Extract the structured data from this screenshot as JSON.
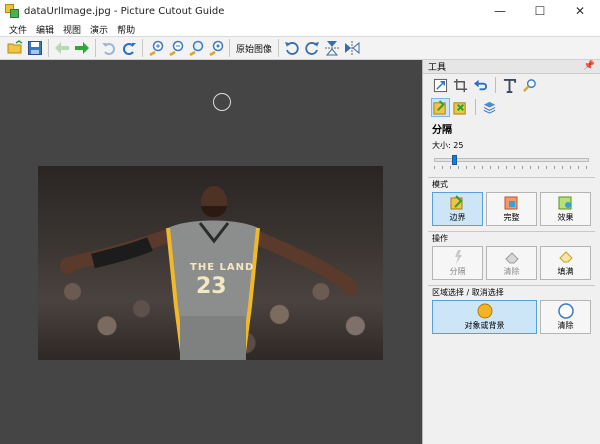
{
  "window": {
    "title": "dataUrlImage.jpg - Picture Cutout Guide",
    "minimize": "—",
    "maximize": "☐",
    "close": "✕"
  },
  "menu": [
    "文件",
    "编辑",
    "视图",
    "演示",
    "帮助"
  ],
  "toolbar": {
    "original_image_label": "原始图像",
    "icons": [
      "open-icon",
      "save-icon",
      "back-icon",
      "forward-icon",
      "undo-icon",
      "redo-icon",
      "zoom-in-icon",
      "zoom-out-icon",
      "zoom-fit-icon",
      "zoom-actual-icon",
      "rotate-left-icon",
      "rotate-right-icon",
      "flip-vertical-icon",
      "flip-horizontal-icon"
    ]
  },
  "photo": {
    "jersey_text": "THE LAND",
    "jersey_number": "23"
  },
  "panel": {
    "title": "工具",
    "section": "分隔",
    "size_label": "大小: 25",
    "size_value": 25,
    "mode_group": "模式",
    "mode_buttons": [
      "边界",
      "完整",
      "效果"
    ],
    "ops_group": "操作",
    "ops_buttons": [
      "分隔",
      "清除",
      "填满"
    ],
    "select_group": "区域选择 / 取消选择",
    "select_primary": "对象或背景",
    "select_clear": "清除"
  }
}
